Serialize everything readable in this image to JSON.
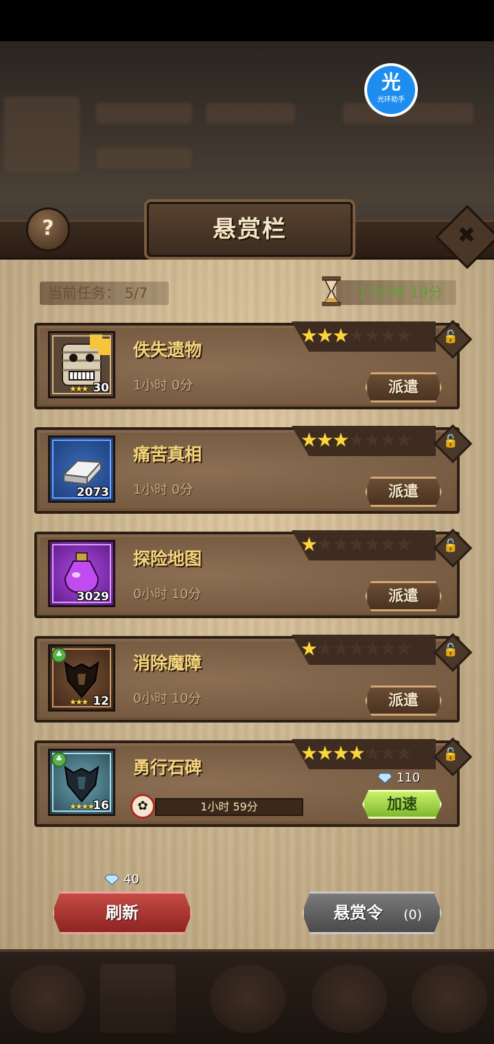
{
  "brand": {
    "char": "光",
    "text": "光环助手"
  },
  "header": {
    "title": "悬赏栏",
    "help_label": "?",
    "close_label": "✖"
  },
  "status": {
    "task_count": "当前任务：  5/7",
    "timer": "17小时 19分"
  },
  "tasks": [
    {
      "name": "佚失遗物",
      "duration": "1小时 0分",
      "count": "30",
      "mini_stars": "★★★",
      "stars_on": 3,
      "button": "派遣",
      "icon": "mummy-hero-icon",
      "badge": "fragment"
    },
    {
      "name": "痛苦真相",
      "duration": "1小时 0分",
      "count": "2073",
      "mini_stars": "",
      "stars_on": 3,
      "button": "派遣",
      "icon": "silver-ingot-icon",
      "badge": ""
    },
    {
      "name": "探险地图",
      "duration": "0小时 10分",
      "count": "3029",
      "mini_stars": "",
      "stars_on": 1,
      "button": "派遣",
      "icon": "purple-potion-icon",
      "badge": ""
    },
    {
      "name": "消除魔障",
      "duration": "0小时 10分",
      "count": "12",
      "mini_stars": "★★★",
      "stars_on": 1,
      "button": "派遣",
      "icon": "dark-armor-icon",
      "badge": "green"
    },
    {
      "name": "勇行石碑",
      "progress_text": "1小时 59分",
      "count": "16",
      "mini_stars": "★★★★",
      "stars_on": 4,
      "speed_cost": "110",
      "button": "加速",
      "icon": "crystal-armor-icon",
      "badge": "green"
    }
  ],
  "bottom": {
    "refresh_cost": "40",
    "refresh_label": "刷新",
    "order_label": "悬赏令",
    "order_count": "(0)"
  },
  "colors": {
    "gold": "#f4d47a",
    "green_timer": "#5ea033",
    "red_button": "#c64a44",
    "speed_green": "#a6dc4a"
  }
}
